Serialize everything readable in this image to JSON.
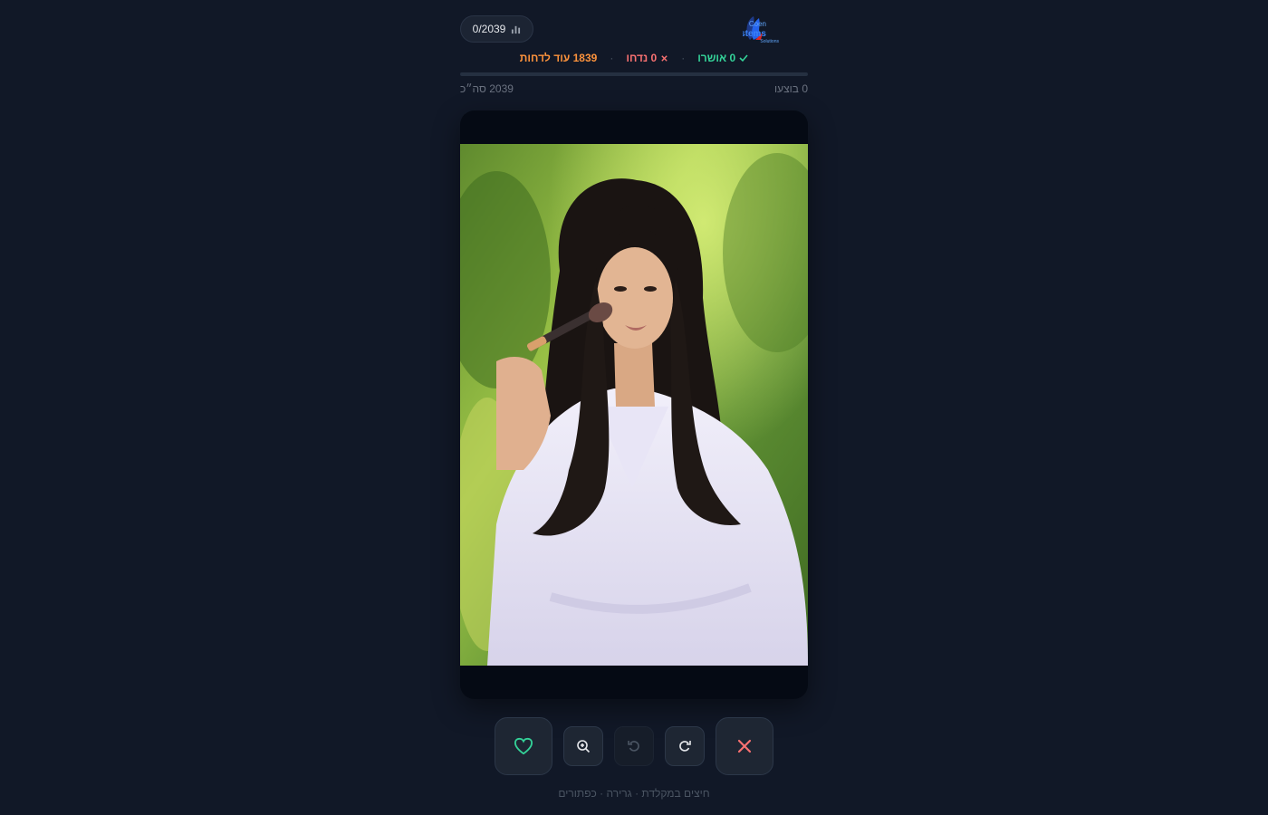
{
  "header": {
    "counter": "0/2039",
    "counter_icon": "bar-chart-icon",
    "logo_text_top": "Coen",
    "logo_text_main": "Systems",
    "logo_text_sub": "Solutions"
  },
  "stats": {
    "approved_label": "0 אושרו",
    "rejected_label": "0 נדחו",
    "remaining_label": "1839 עוד לדחות",
    "separator": "·"
  },
  "progress": {
    "fraction": 0.0
  },
  "subinfo": {
    "done": "0 בוצעו",
    "total": "2039 סה״כ"
  },
  "controls": {
    "like": "heart-icon",
    "zoom": "zoom-in-icon",
    "undo": "undo-icon",
    "rotate": "rotate-icon",
    "reject": "close-icon"
  },
  "hint": "חיצים במקלדת · גרירה · כפתורים",
  "colors": {
    "approved": "#34d399",
    "rejected": "#f87171",
    "remaining": "#fb923c",
    "background": "#111827"
  }
}
